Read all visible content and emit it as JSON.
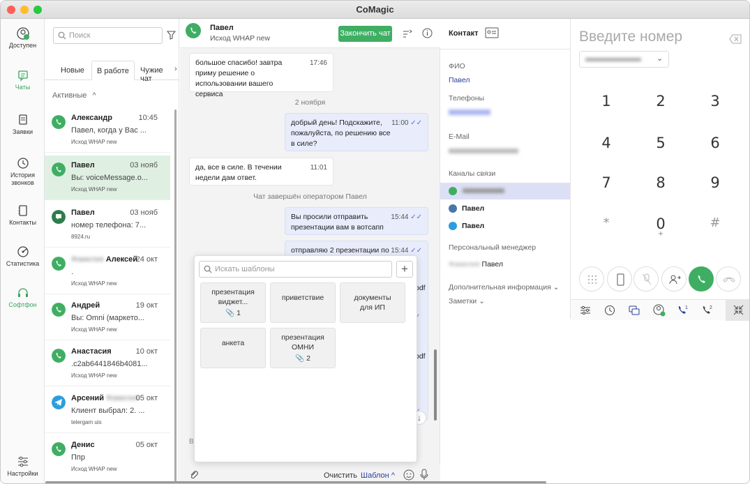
{
  "window": {
    "title": "CoMagic"
  },
  "nav": [
    {
      "label": "Доступен",
      "icon": "user-available-icon"
    },
    {
      "label": "Чаты",
      "icon": "chat-icon"
    },
    {
      "label": "Заявки",
      "icon": "requests-icon"
    },
    {
      "label": "История звонков",
      "icon": "clock-icon"
    },
    {
      "label": "Контакты",
      "icon": "contacts-book-icon"
    },
    {
      "label": "Статистика",
      "icon": "statistics-icon"
    },
    {
      "label": "Софтфон",
      "icon": "headset-icon"
    },
    {
      "label": "Настройки",
      "icon": "settings-sliders-icon"
    }
  ],
  "list": {
    "search_placeholder": "Поиск",
    "tabs": [
      "Новые",
      "В работе",
      "Чужие чат"
    ],
    "section": "Активные",
    "conversations": [
      {
        "name": "Александр",
        "date": "10:45",
        "preview": "Павел, когда у Вас ...",
        "source": "Исход WHAP new",
        "channel": "whatsapp"
      },
      {
        "name": "Павел",
        "date": "03 нояб",
        "preview": "Вы: voiceMessage.o...",
        "source": "Исход WHAP new",
        "channel": "whatsapp"
      },
      {
        "name": "Павел",
        "date": "03 нояб",
        "preview": "номер телефона: 7...",
        "source": "8924.ru",
        "channel": "widget"
      },
      {
        "name": "Алексей",
        "date": "24 окт",
        "preview": ".",
        "source": "Исход WHAP new",
        "channel": "whatsapp"
      },
      {
        "name": "Андрей",
        "date": "19 окт",
        "preview": "Вы: Omni (маркето...",
        "source": "Исход WHAP new",
        "channel": "whatsapp"
      },
      {
        "name": "Анастасия",
        "date": "10 окт",
        "preview": ".c2ab6441846b4081...",
        "source": "Исход WHAP new",
        "channel": "whatsapp"
      },
      {
        "name": "Арсений",
        "date": "05 окт",
        "preview": "Клиент выбрал: 2. ...",
        "source": "telergam uis",
        "channel": "telegram"
      },
      {
        "name": "Денис",
        "date": "05 окт",
        "preview": "Ппр",
        "source": "Исход WHAP new",
        "channel": "whatsapp"
      }
    ]
  },
  "chat": {
    "contact_name": "Павел",
    "channel_name": "Исход WHAP new",
    "finish_button": "Закончить чат",
    "messages": [
      {
        "dir": "in",
        "text": "большое спасибо! завтра приму решение о использовании вашего сервиса",
        "time": "17:46"
      },
      {
        "dir": "sys",
        "text": "2 ноября"
      },
      {
        "dir": "out",
        "text": "добрый день! Подскажите, пожалуйста, по решению все в силе?",
        "time": "11:00"
      },
      {
        "dir": "in",
        "text": "да, все в силе. В течении недели дам ответ.",
        "time": "11:01"
      },
      {
        "dir": "sys",
        "text": "Чат завершён оператором Павел"
      },
      {
        "dir": "out",
        "text": "Вы просили отправить презентации вам в вотсапп",
        "time": "15:44"
      },
      {
        "dir": "out",
        "text": "отправляю 2 презентации по",
        "time": "15:44"
      }
    ],
    "footer": {
      "clear": "Очистить",
      "template": "Шаблон"
    },
    "templates_popup": {
      "search_placeholder": "Искать шаблоны",
      "items": [
        {
          "title": "презентация виджет...",
          "attachments": "1"
        },
        {
          "title": "приветствие",
          "attachments": ""
        },
        {
          "title": "документы для ИП",
          "attachments": ""
        },
        {
          "title": "анкета",
          "attachments": ""
        },
        {
          "title": "презентация ОМНИ",
          "attachments": "2"
        }
      ]
    },
    "hidden_fragments": {
      "a": "odf",
      "b": "odf",
      "c": "Вв"
    }
  },
  "contact": {
    "header": "Контакт",
    "fio_label": "ФИО",
    "fio_value": "Павел",
    "phones_label": "Телефоны",
    "email_label": "E-Mail",
    "channels_label": "Каналы связи",
    "channels": [
      {
        "type": "whatsapp",
        "name": ""
      },
      {
        "type": "vk",
        "name": "Павел"
      },
      {
        "type": "telegram",
        "name": "Павел"
      }
    ],
    "manager_label": "Персональный менеджер",
    "manager_name": "Павел",
    "extra_label": "Дополнительная информация",
    "notes_label": "Заметки"
  },
  "phone": {
    "placeholder": "Введите номер",
    "keys": [
      "1",
      "2",
      "3",
      "4",
      "5",
      "6",
      "7",
      "8",
      "9",
      "*",
      "0",
      "#"
    ],
    "zero_sub": "+",
    "line1": "1",
    "line2": "2"
  },
  "colors": {
    "accent": "#3fae63",
    "link": "#2a3e9a",
    "selected": "#dff0e3"
  }
}
